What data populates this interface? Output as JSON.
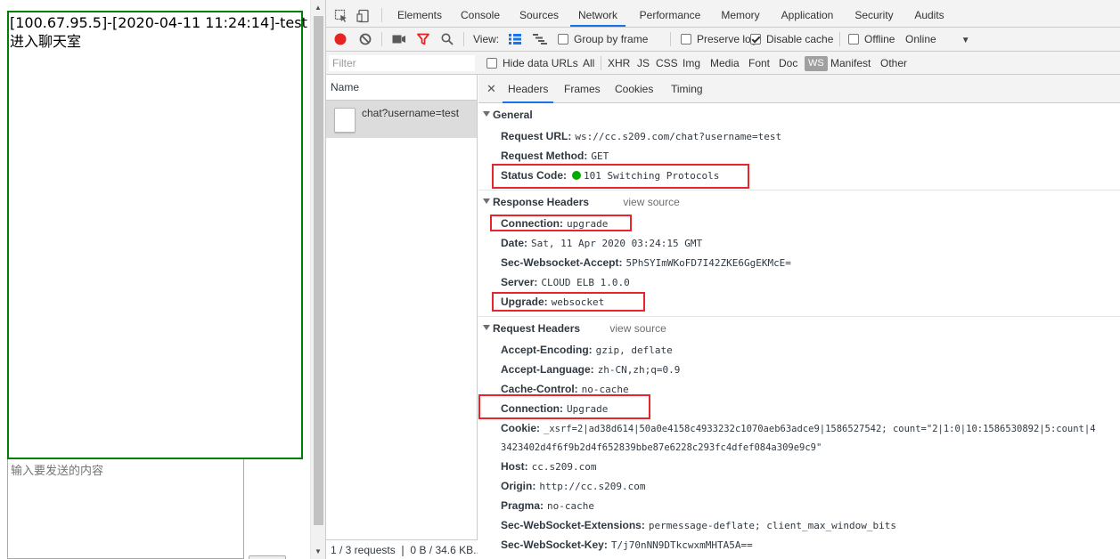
{
  "page": {
    "chat_lines": [
      "[100.67.95.5]-[2020-04-11 11:24:14]-test",
      "进入聊天室"
    ],
    "message_placeholder": "输入要发送的内容"
  },
  "devtools": {
    "tabs": [
      "Elements",
      "Console",
      "Sources",
      "Network",
      "Performance",
      "Memory",
      "Application",
      "Security",
      "Audits"
    ],
    "active_tab": "Network",
    "controls": {
      "view_label": "View:",
      "group_by_frame": "Group by frame",
      "preserve_log": "Preserve log",
      "disable_cache": "Disable cache",
      "offline": "Offline",
      "online": "Online"
    },
    "filter": {
      "placeholder": "Filter",
      "hide_data_urls": "Hide data URLs",
      "types": [
        "All",
        "XHR",
        "JS",
        "CSS",
        "Img",
        "Media",
        "Font",
        "Doc",
        "WS",
        "Manifest",
        "Other"
      ],
      "active_type": "WS"
    },
    "list": {
      "header": "Name",
      "request_name": "chat?username=test",
      "status": "1 / 3 requests ❘ 0 B / 34.6 KB..."
    },
    "detail_tabs": [
      "Headers",
      "Frames",
      "Cookies",
      "Timing"
    ],
    "active_detail_tab": "Headers",
    "general": {
      "title": "General",
      "rows": [
        {
          "name": "Request URL:",
          "value": "ws://cc.s209.com/chat?username=test"
        },
        {
          "name": "Request Method:",
          "value": "GET"
        },
        {
          "name": "Status Code:",
          "value": "101 Switching Protocols"
        }
      ]
    },
    "response_headers": {
      "title": "Response Headers",
      "view_source": "view source",
      "rows": [
        {
          "name": "Connection:",
          "value": "upgrade"
        },
        {
          "name": "Date:",
          "value": "Sat, 11 Apr 2020 03:24:15 GMT"
        },
        {
          "name": "Sec-Websocket-Accept:",
          "value": "5PhSYImWKoFD7I42ZKE6GgEKMcE="
        },
        {
          "name": "Server:",
          "value": "CLOUD ELB 1.0.0"
        },
        {
          "name": "Upgrade:",
          "value": "websocket"
        }
      ]
    },
    "request_headers": {
      "title": "Request Headers",
      "view_source": "view source",
      "rows": [
        {
          "name": "Accept-Encoding:",
          "value": "gzip, deflate"
        },
        {
          "name": "Accept-Language:",
          "value": "zh-CN,zh;q=0.9"
        },
        {
          "name": "Cache-Control:",
          "value": "no-cache"
        },
        {
          "name": "Connection:",
          "value": "Upgrade"
        },
        {
          "name": "Cookie:",
          "value": "_xsrf=2|ad38d614|50a0e4158c4933232c1070aeb63adce9|1586527542; count=\"2|1:0|10:1586530892|5:count|4"
        },
        {
          "name": "Host:",
          "value": "cc.s209.com"
        },
        {
          "name": "Origin:",
          "value": "http://cc.s209.com"
        },
        {
          "name": "Pragma:",
          "value": "no-cache"
        },
        {
          "name": "Sec-WebSocket-Extensions:",
          "value": "permessage-deflate; client_max_window_bits"
        },
        {
          "name": "Sec-WebSocket-Key:",
          "value": "T/j70nNN9DTkcwxmMHTA5A=="
        }
      ],
      "cookie_continuation": "3423402d4f6f9b2d4f652839bbe87e6228c293fc4dfef084a309e9c9\""
    },
    "colors": {
      "highlight_box": "#e8252a",
      "status_dot": "#00aa00",
      "record_button": "#e52521",
      "tab_underline": "#1a73e8",
      "chat_border": "#008000"
    }
  }
}
